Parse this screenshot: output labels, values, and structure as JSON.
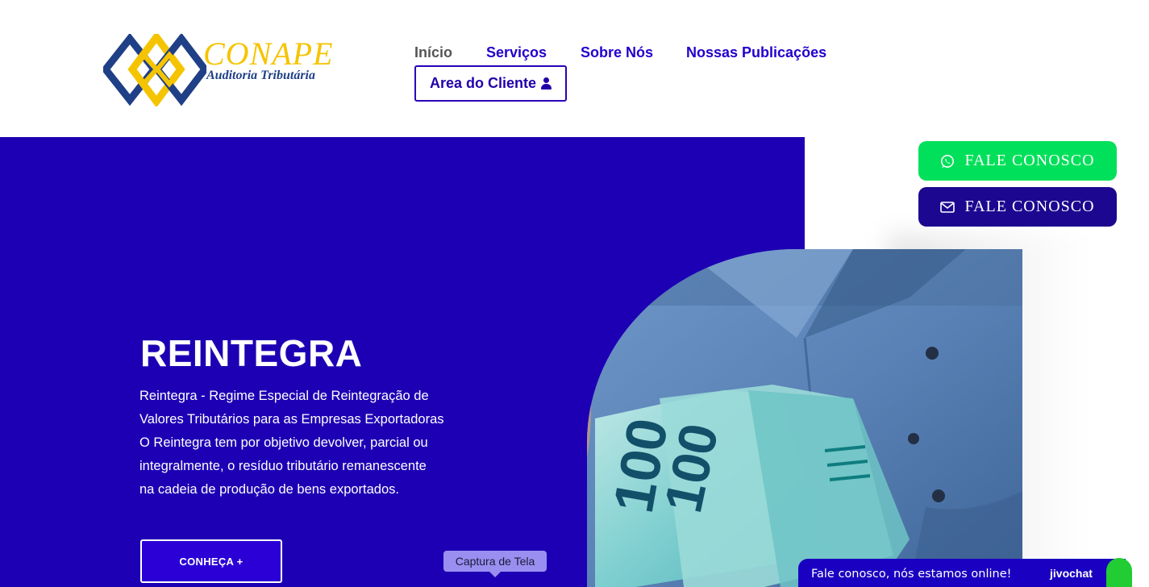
{
  "brand": {
    "name": "CONAPE",
    "tagline": "Auditoria Tributária",
    "colors": {
      "navy": "#1f3f86",
      "gold": "#f5c400"
    }
  },
  "nav": {
    "items": [
      {
        "label": "Início",
        "active": true
      },
      {
        "label": "Serviços",
        "active": false
      },
      {
        "label": "Sobre Nós",
        "active": false
      },
      {
        "label": "Nossas Publicações",
        "active": false
      }
    ],
    "client_button": {
      "label": "Area do Cliente",
      "icon": "user-icon"
    }
  },
  "hero": {
    "title": "REINTEGRA",
    "paragraph_lines": [
      "Reintegra - Regime Especial de Reintegração de",
      "Valores Tributários para as Empresas Exportadoras",
      "O Reintegra tem por objetivo devolver, parcial ou",
      "integralmente, o resíduo tributário remanescente",
      "na cadeia de produção de bens exportados."
    ],
    "cta_label": "CONHEÇA +",
    "background_color": "#1d00b4"
  },
  "tooltip": {
    "label": "Captura de Tela"
  },
  "contact": {
    "whatsapp": {
      "label": "FALE CONOSCO",
      "icon": "whatsapp-icon",
      "color": "#00e05a"
    },
    "email": {
      "label": "FALE CONOSCO",
      "icon": "mail-icon",
      "color": "#1c0890"
    }
  },
  "chat": {
    "text": "Fale conosco, nós estamos online!",
    "brand": "jivochat"
  },
  "photo": {
    "description_icon": "money-photo",
    "banknote_denomination": "100"
  }
}
